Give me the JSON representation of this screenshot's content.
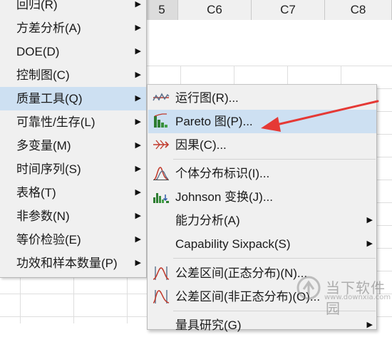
{
  "columns": [
    {
      "label": "5",
      "active": true
    },
    {
      "label": "C6",
      "active": false
    },
    {
      "label": "C7",
      "active": false
    },
    {
      "label": "C8",
      "active": false
    }
  ],
  "left_menu": {
    "items": [
      {
        "label": "回归(R)",
        "arrow": "▶"
      },
      {
        "label": "方差分析(A)",
        "arrow": "▶"
      },
      {
        "label": "DOE(D)",
        "arrow": "▶"
      },
      {
        "label": "控制图(C)",
        "arrow": "▶"
      },
      {
        "label": "质量工具(Q)",
        "arrow": "▶",
        "selected": true
      },
      {
        "label": "可靠性/生存(L)",
        "arrow": "▶"
      },
      {
        "label": "多变量(M)",
        "arrow": "▶"
      },
      {
        "label": "时间序列(S)",
        "arrow": "▶"
      },
      {
        "label": "表格(T)",
        "arrow": "▶"
      },
      {
        "label": "非参数(N)",
        "arrow": "▶"
      },
      {
        "label": "等价检验(E)",
        "arrow": "▶"
      },
      {
        "label": "功效和样本数量(P)",
        "arrow": "▶"
      }
    ]
  },
  "sub_menu": {
    "items": [
      {
        "label": "运行图(R)...",
        "icon": "run-chart-icon"
      },
      {
        "label": "Pareto 图(P)...",
        "icon": "pareto-chart-icon",
        "selected": true
      },
      {
        "label": "因果(C)...",
        "icon": "cause-effect-icon"
      },
      {
        "label": "个体分布标识(I)...",
        "icon": "distribution-id-icon"
      },
      {
        "label": "Johnson 变换(J)...",
        "icon": "johnson-transform-icon"
      },
      {
        "label": "能力分析(A)",
        "arrow": "▶"
      },
      {
        "label": "Capability Sixpack(S)",
        "arrow": "▶"
      },
      {
        "label": "公差区间(正态分布)(N)...",
        "icon": "tolerance-normal-icon"
      },
      {
        "label": "公差区间(非正态分布)(O)...",
        "icon": "tolerance-nonnormal-icon"
      },
      {
        "label": "量具研究(G)",
        "arrow": "▶"
      }
    ]
  },
  "watermark": {
    "title": "当下软件园",
    "url": "www.downxia.com"
  },
  "colors": {
    "menu_bg": "#f0f0f0",
    "selection": "#cde0f2",
    "annotation_arrow": "#e53935"
  }
}
